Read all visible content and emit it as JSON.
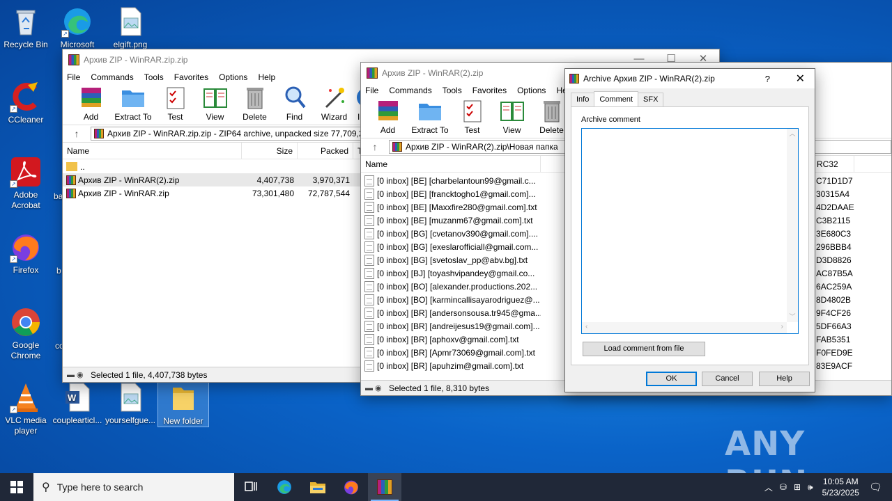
{
  "desktop": {
    "icons": [
      {
        "label": "Recycle Bin"
      },
      {
        "label": "Microsoft"
      },
      {
        "label": "elgift.png"
      },
      {
        "label": "CCleaner"
      },
      {
        "label": "Adobe Acrobat"
      },
      {
        "label": "Firefox"
      },
      {
        "label": "Google Chrome"
      },
      {
        "label": "VLC media player"
      },
      {
        "label": "couplearticl..."
      },
      {
        "label": "yourselfgue..."
      },
      {
        "label": "New folder"
      }
    ],
    "hidden_labels": [
      "ba",
      "b",
      "co"
    ]
  },
  "win1": {
    "title": "Архив ZIP - WinRAR.zip.zip",
    "menu": [
      "File",
      "Commands",
      "Tools",
      "Favorites",
      "Options",
      "Help"
    ],
    "toolbar": [
      "Add",
      "Extract To",
      "Test",
      "View",
      "Delete",
      "Find",
      "Wizard",
      "In"
    ],
    "address": "Архив ZIP - WinRAR.zip.zip - ZIP64 archive, unpacked size 77,709,2",
    "columns": [
      "Name",
      "Size",
      "Packed",
      "T"
    ],
    "rows": [
      {
        "name": "..",
        "size": "",
        "packed": ""
      },
      {
        "name": "Архив ZIP - WinRAR(2).zip",
        "size": "4,407,738",
        "packed": "3,970,371"
      },
      {
        "name": "Архив ZIP - WinRAR.zip",
        "size": "73,301,480",
        "packed": "72,787,544"
      }
    ],
    "status": "Selected 1 file, 4,407,738 bytes"
  },
  "win2": {
    "title": "Архив ZIP - WinRAR(2).zip",
    "menu": [
      "File",
      "Commands",
      "Tools",
      "Favorites",
      "Options",
      "Help"
    ],
    "toolbar": [
      "Add",
      "Extract To",
      "Test",
      "View",
      "Delete"
    ],
    "address": "Архив ZIP - WinRAR(2).zip\\Новая папка",
    "columns": [
      "Name",
      "RC32"
    ],
    "rows": [
      {
        "name": "[0 inbox] [BE] [charbelantoun99@gmail.c...",
        "crc": "C71D1D7"
      },
      {
        "name": "[0 inbox] [BE] [francktogho1@gmail.com]...",
        "crc": "30315A4"
      },
      {
        "name": "[0 inbox] [BE] [Maxxfire280@gmail.com].txt",
        "crc": "4D2DAAE"
      },
      {
        "name": "[0 inbox] [BE] [muzanm67@gmail.com].txt",
        "crc": "C3B2115"
      },
      {
        "name": "[0 inbox] [BG] [cvetanov390@gmail.com]....",
        "crc": "3E680C3"
      },
      {
        "name": "[0 inbox] [BG] [exeslarofficiall@gmail.com...",
        "crc": "296BBB4"
      },
      {
        "name": "[0 inbox] [BG] [svetoslav_pp@abv.bg].txt",
        "crc": "D3D8826"
      },
      {
        "name": "[0 inbox] [BJ] [toyashvipandey@gmail.co...",
        "crc": "AC87B5A"
      },
      {
        "name": "[0 inbox] [BO] [alexander.productions.202...",
        "crc": "6AC259A"
      },
      {
        "name": "[0 inbox] [BO] [karmincallisayarodriguez@...",
        "crc": "8D4802B"
      },
      {
        "name": "[0 inbox] [BR] [andersonsousa.tr945@gma...",
        "crc": "9F4CF26"
      },
      {
        "name": "[0 inbox] [BR] [andreijesus19@gmail.com]...",
        "crc": "5DF66A3"
      },
      {
        "name": "[0 inbox] [BR] [aphoxv@gmail.com].txt",
        "crc": "FAB5351"
      },
      {
        "name": "[0 inbox] [BR] [Apmr73069@gmail.com].txt",
        "crc": "F0FED9E"
      },
      {
        "name": "[0 inbox] [BR] [apuhzim@gmail.com].txt",
        "crc": "83E9ACF"
      }
    ],
    "status": "Selected 1 file, 8,310 bytes"
  },
  "dialog": {
    "title": "Archive Архив ZIP - WinRAR(2).zip",
    "help_glyph": "?",
    "tabs": [
      "Info",
      "Comment",
      "SFX"
    ],
    "comment_label": "Archive comment",
    "comment_value": "",
    "load_button": "Load comment from file",
    "ok": "OK",
    "cancel": "Cancel",
    "help": "Help"
  },
  "taskbar": {
    "search_placeholder": "Type here to search",
    "time": "10:05 AM",
    "date": "5/23/2025"
  },
  "watermark": "ANY RUN"
}
